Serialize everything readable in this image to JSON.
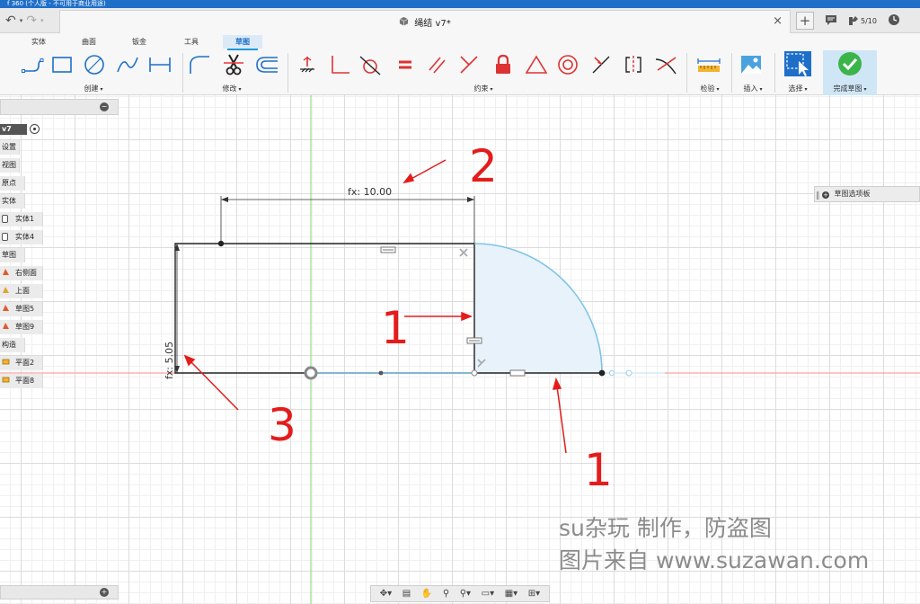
{
  "window": {
    "title_fragment": "f 360 (个人版 - 不可用于商业用途)"
  },
  "document_tab": {
    "title": "绳结 v7*",
    "close": "×"
  },
  "tabbar": {
    "job_status": "5/10"
  },
  "ribbon": {
    "tabs": [
      {
        "label": "实体",
        "active": false
      },
      {
        "label": "曲面",
        "active": false
      },
      {
        "label": "钣金",
        "active": false
      },
      {
        "label": "工具",
        "active": false
      },
      {
        "label": "草图",
        "active": true
      }
    ],
    "groups": {
      "create": "创建",
      "modify": "修改",
      "constraints": "约束",
      "inspect": "检验",
      "insert": "插入",
      "select": "选择",
      "finish": "完成草图"
    },
    "accent_color": "#1f9ad8"
  },
  "browser": {
    "root_label": "v7",
    "items": [
      {
        "label": "设置",
        "kind": "plain"
      },
      {
        "label": "视图",
        "kind": "plain"
      },
      {
        "label": "原点",
        "kind": "plain"
      },
      {
        "label": "实体",
        "kind": "plain"
      },
      {
        "label": "实体1",
        "kind": "checkbox"
      },
      {
        "label": "实体4",
        "kind": "checkbox"
      },
      {
        "label": "草图",
        "kind": "plain"
      },
      {
        "label": "右侧面",
        "kind": "sketch"
      },
      {
        "label": "上面",
        "kind": "sketch"
      },
      {
        "label": "草图5",
        "kind": "sketch"
      },
      {
        "label": "草图9",
        "kind": "sketch"
      },
      {
        "label": "构造",
        "kind": "plain"
      },
      {
        "label": "平面2",
        "kind": "plane"
      },
      {
        "label": "平面8",
        "kind": "plane"
      }
    ]
  },
  "palette": {
    "label": "草图选项板"
  },
  "sketch": {
    "dimension_width": "fx: 10.00",
    "dimension_height": "fx: 5.05",
    "annotation_1a": "1",
    "annotation_2": "2",
    "annotation_3": "3",
    "annotation_1b": "1",
    "annotation_color": "#e41c1c",
    "profile_fill": "#e8f2fa",
    "arc_color": "#7fc4e8"
  },
  "watermark": {
    "line1": "su杂玩 制作，防盗图",
    "line2": "图片来自 www.suzawan.com"
  }
}
